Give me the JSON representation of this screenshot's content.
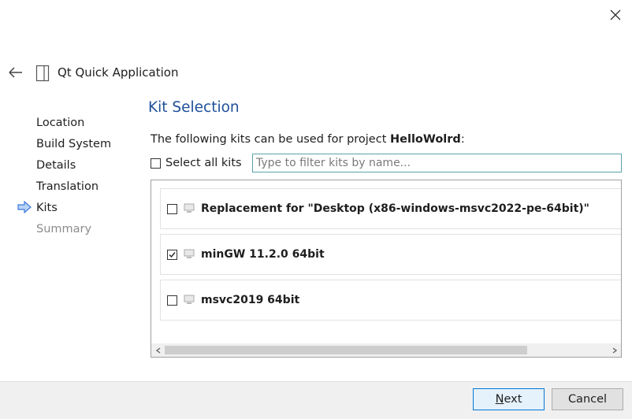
{
  "window": {
    "title": "Qt Quick Application"
  },
  "steps": [
    {
      "label": "Location",
      "state": "done"
    },
    {
      "label": "Build System",
      "state": "done"
    },
    {
      "label": "Details",
      "state": "done"
    },
    {
      "label": "Translation",
      "state": "done"
    },
    {
      "label": "Kits",
      "state": "current"
    },
    {
      "label": "Summary",
      "state": "disabled"
    }
  ],
  "page": {
    "title": "Kit Selection",
    "desc_prefix": "The following kits can be used for project ",
    "project_name": "HelloWolrd",
    "desc_suffix": ":",
    "select_all_label": "Select all kits",
    "filter_placeholder": "Type to filter kits by name..."
  },
  "kits": [
    {
      "label": "Replacement for \"Desktop (x86-windows-msvc2022-pe-64bit)\"",
      "checked": false
    },
    {
      "label": "minGW 11.2.0 64bit",
      "checked": true
    },
    {
      "label": "msvc2019 64bit",
      "checked": false
    }
  ],
  "buttons": {
    "next_mnemonic": "N",
    "next_rest": "ext",
    "cancel": "Cancel"
  },
  "colors": {
    "title": "#1f4f99",
    "accent": "#0078d7",
    "arrow": "#3d7ad9"
  }
}
